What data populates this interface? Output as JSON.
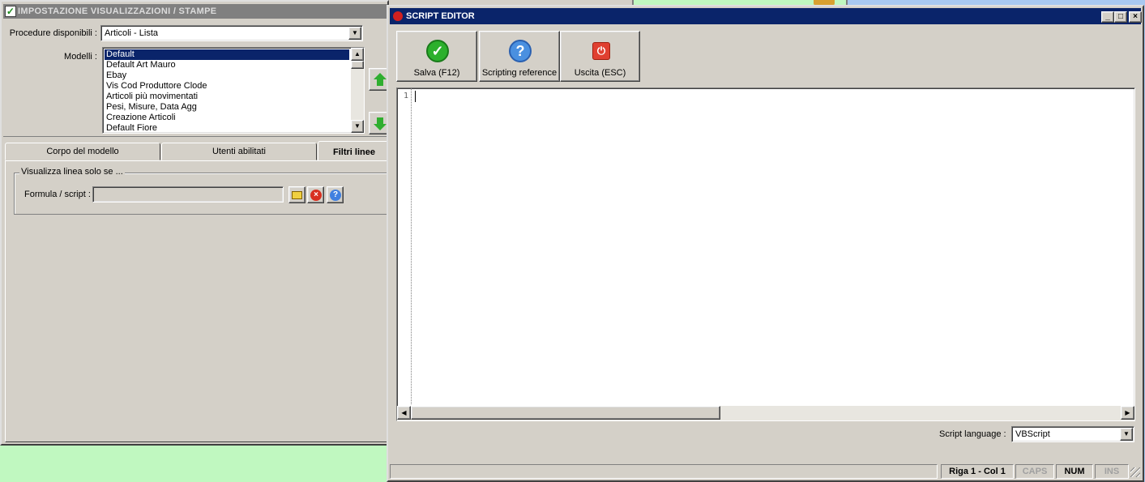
{
  "left_window": {
    "title": "IMPOSTAZIONE VISUALIZZAZIONI / STAMPE",
    "procedure_label": "Procedure disponibili :",
    "procedure_value": "Articoli - Lista",
    "models_label": "Modelli :",
    "models": [
      "Default",
      "Default Art Mauro",
      "Ebay",
      "Vis Cod Produttore Clode",
      "Articoli più movimentati",
      "Pesi, Misure, Data Agg",
      "Creazione Articoli",
      "Default Fiore"
    ],
    "selected_model_index": 0,
    "tabs": [
      {
        "label": "Corpo del modello"
      },
      {
        "label": "Utenti abilitati"
      },
      {
        "label": "Filtri linee"
      }
    ],
    "active_tab": "Filtri linee",
    "group_title": "Visualizza linea solo se ...",
    "formula_label": "Formula / script :",
    "formula_value": ""
  },
  "editor": {
    "title": "SCRIPT EDITOR",
    "toolbar": {
      "save_label": "Salva (F12)",
      "reference_label": "Scripting reference",
      "exit_label": "Uscita (ESC)"
    },
    "line_number": "1",
    "script_language_label": "Script language :",
    "script_language_value": "VBScript",
    "status": {
      "main": "",
      "position": "Riga 1 - Col 1",
      "caps": "CAPS",
      "num": "NUM",
      "ins": "INS"
    }
  },
  "colors": {
    "titlebar_active": "#0a246a",
    "titlebar_inactive": "#808080",
    "face": "#d4d0c8",
    "desktop_green": "#c0f8c0"
  }
}
